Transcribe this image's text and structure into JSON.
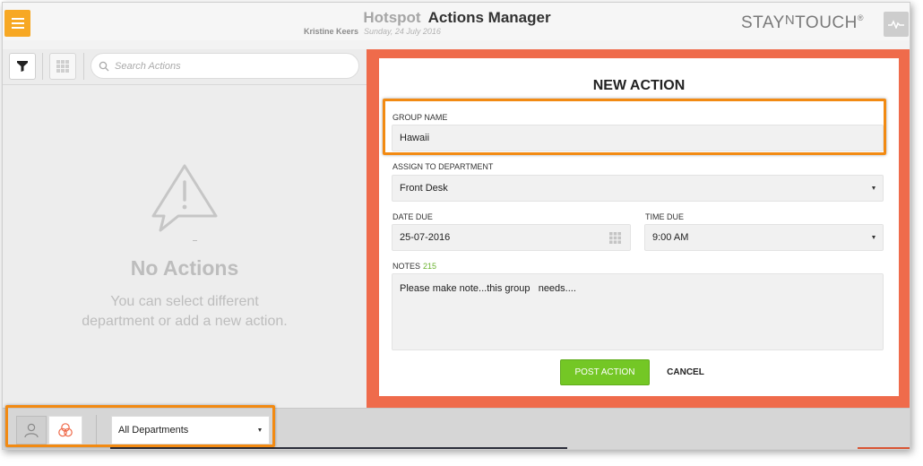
{
  "header": {
    "menu_icon": "hamburger-menu-icon",
    "app_name": "Hotspot",
    "title": "Actions Manager",
    "user": "Kristine Keers",
    "date": "Sunday, 24 July 2016",
    "logo_pre": "STAY",
    "logo_n": "N",
    "logo_post": "TOUCH",
    "logo_reg": "®",
    "pulse_icon": "activity-pulse-icon"
  },
  "left": {
    "filter_icon": "filter-funnel-icon",
    "grid_icon": "grid-view-icon",
    "search": {
      "placeholder": "Search Actions",
      "value": ""
    },
    "empty": {
      "icon": "warning-speech-bubble-icon",
      "title": "No Actions",
      "line1": "You can select different",
      "line2": "department or add a new action."
    }
  },
  "form": {
    "title": "NEW ACTION",
    "group_name": {
      "label": "GROUP NAME",
      "value": "Hawaii"
    },
    "department": {
      "label": "ASSIGN TO DEPARTMENT",
      "value": "Front Desk"
    },
    "date_due": {
      "label": "DATE DUE",
      "value": "25-07-2016",
      "icon": "calendar-icon"
    },
    "time_due": {
      "label": "TIME DUE",
      "value": "9:00 AM"
    },
    "notes": {
      "label": "NOTES",
      "count": "215",
      "value": "Please make note...this group   needs...."
    },
    "post_label": "POST ACTION",
    "cancel_label": "CANCEL"
  },
  "bottom": {
    "person_icon": "person-icon",
    "circles_icon": "venn-circles-icon",
    "department_filter": "All Departments"
  },
  "colors": {
    "accent_orange": "#f7a824",
    "panel_coral": "#ef6b4b",
    "post_green": "#74c725",
    "notes_count_green": "#6ab22e",
    "highlight_orange": "#f28a12"
  }
}
